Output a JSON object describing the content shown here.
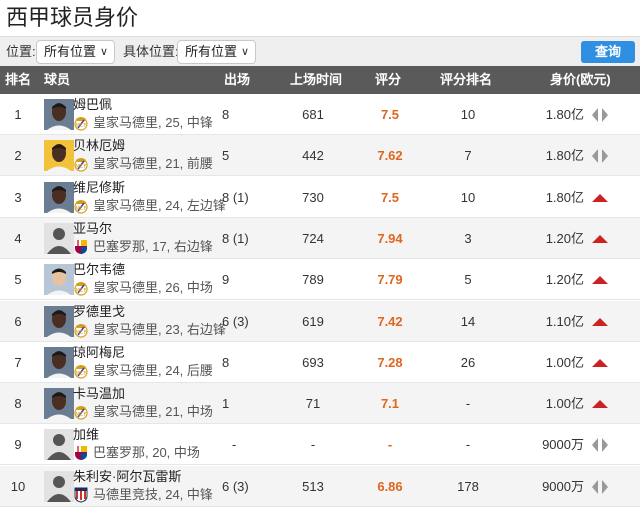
{
  "page_title": "西甲球员身价",
  "filters": {
    "position_label": "位置:",
    "position_value": "所有位置",
    "specific_label": "具体位置:",
    "specific_value": "所有位置",
    "query_button": "查询"
  },
  "columns": {
    "rank": "排名",
    "player": "球员",
    "apps": "出场",
    "minutes": "上场时间",
    "rating": "评分",
    "rating_rank": "评分排名",
    "value": "身价(欧元)"
  },
  "colors": {
    "accent": "#2f8fe3",
    "rating": "#e0661e",
    "trend_up": "#cc2222",
    "trend_flat": "#999999",
    "header_bg": "#5a5a5a"
  },
  "rows": [
    {
      "rank": "1",
      "name": "姆巴佩",
      "club": "皇家马德里, 25, 中锋",
      "club_icon": "real-madrid-badge",
      "apps": "8",
      "minutes": "681",
      "rating": "7.5",
      "rating_rank": "10",
      "value": "1.80亿",
      "trend": "flat",
      "avatar": "dark"
    },
    {
      "rank": "2",
      "name": "贝林厄姆",
      "club": "皇家马德里, 21, 前腰",
      "club_icon": "real-madrid-badge",
      "apps": "5",
      "minutes": "442",
      "rating": "7.62",
      "rating_rank": "7",
      "value": "1.80亿",
      "trend": "flat",
      "avatar": "yellow"
    },
    {
      "rank": "3",
      "name": "维尼修斯",
      "club": "皇家马德里, 24, 左边锋",
      "club_icon": "real-madrid-badge",
      "apps": "8 (1)",
      "minutes": "730",
      "rating": "7.5",
      "rating_rank": "10",
      "value": "1.80亿",
      "trend": "up",
      "avatar": "dark"
    },
    {
      "rank": "4",
      "name": "亚马尔",
      "club": "巴塞罗那, 17, 右边锋",
      "club_icon": "barcelona-badge",
      "apps": "8 (1)",
      "minutes": "724",
      "rating": "7.94",
      "rating_rank": "3",
      "value": "1.20亿",
      "trend": "up",
      "avatar": "placeholder"
    },
    {
      "rank": "5",
      "name": "巴尔韦德",
      "club": "皇家马德里, 26, 中场",
      "club_icon": "real-madrid-badge",
      "apps": "9",
      "minutes": "789",
      "rating": "7.79",
      "rating_rank": "5",
      "value": "1.20亿",
      "trend": "up",
      "avatar": "light"
    },
    {
      "rank": "6",
      "name": "罗德里戈",
      "club": "皇家马德里, 23, 右边锋",
      "club_icon": "real-madrid-badge",
      "apps": "6 (3)",
      "minutes": "619",
      "rating": "7.42",
      "rating_rank": "14",
      "value": "1.10亿",
      "trend": "up",
      "avatar": "dark"
    },
    {
      "rank": "7",
      "name": "琼阿梅尼",
      "club": "皇家马德里, 24, 后腰",
      "club_icon": "real-madrid-badge",
      "apps": "8",
      "minutes": "693",
      "rating": "7.28",
      "rating_rank": "26",
      "value": "1.00亿",
      "trend": "up",
      "avatar": "dark"
    },
    {
      "rank": "8",
      "name": "卡马温加",
      "club": "皇家马德里, 21, 中场",
      "club_icon": "real-madrid-badge",
      "apps": "1",
      "minutes": "71",
      "rating": "7.1",
      "rating_rank": "-",
      "value": "1.00亿",
      "trend": "up",
      "avatar": "dark"
    },
    {
      "rank": "9",
      "name": "加维",
      "club": "巴塞罗那, 20, 中场",
      "club_icon": "barcelona-badge",
      "apps": "-",
      "minutes": "-",
      "rating": "-",
      "rating_rank": "-",
      "value": "9000万",
      "trend": "flat",
      "avatar": "placeholder"
    },
    {
      "rank": "10",
      "name": "朱利安·阿尔瓦雷斯",
      "club": "马德里竞技, 24, 中锋",
      "club_icon": "atletico-badge",
      "apps": "6 (3)",
      "minutes": "513",
      "rating": "6.86",
      "rating_rank": "178",
      "value": "9000万",
      "trend": "flat",
      "avatar": "placeholder"
    }
  ]
}
